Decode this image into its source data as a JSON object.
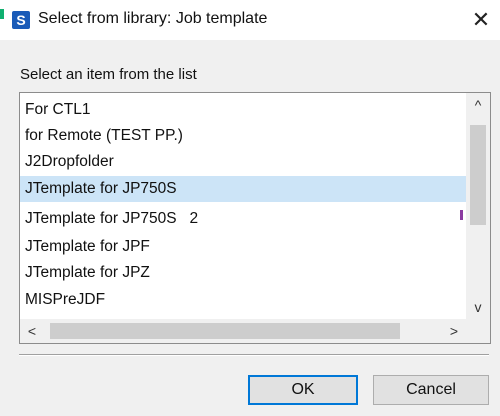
{
  "dialog": {
    "app_icon_letter": "S",
    "title": "Select from library: Job template",
    "close_glyph": "✕",
    "prompt": "Select an item from the list"
  },
  "list": {
    "items": [
      "For CTL1",
      "for Remote (TEST PP.)",
      "J2Dropfolder",
      "JTemplate for JP750S",
      "JTemplate for JP750S   2",
      "JTemplate for JPF",
      "JTemplate for JPZ",
      "MISPreJDF"
    ],
    "selected_index": 3,
    "scroll_up_glyph": "^",
    "scroll_down_glyph": "v",
    "scroll_left_glyph": "<",
    "scroll_right_glyph": ">"
  },
  "buttons": {
    "ok_label": "OK",
    "cancel_label": "Cancel"
  },
  "colors": {
    "selection": "#cce4f7",
    "default_button_border": "#0078d7",
    "app_icon_bg": "#1a5bb8"
  }
}
